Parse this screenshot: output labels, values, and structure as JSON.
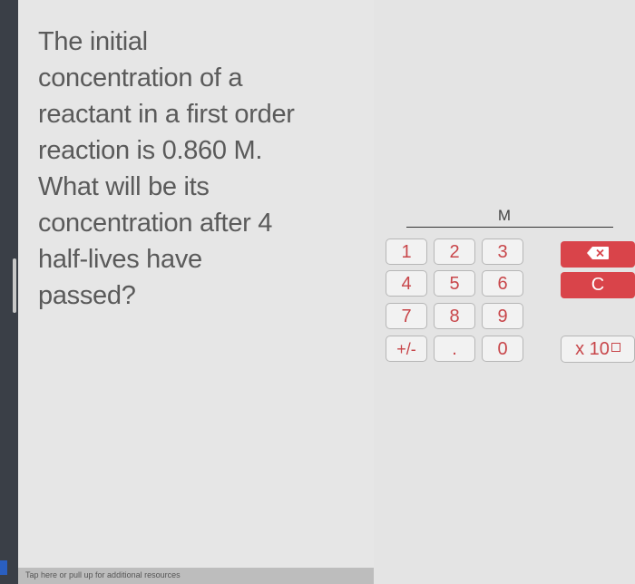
{
  "question": {
    "lines": [
      "The initial",
      "concentration of a",
      "reactant in a first order",
      "reaction is 0.860 M.",
      "What will be its",
      "concentration after 4",
      "half-lives have",
      "passed?"
    ]
  },
  "answer": {
    "value": "",
    "unit": "M"
  },
  "keypad": {
    "keys": [
      "1",
      "2",
      "3",
      "4",
      "5",
      "6",
      "7",
      "8",
      "9",
      "+/-",
      ".",
      "0"
    ],
    "backspace_icon": "backspace-icon",
    "clear_label": "C",
    "exponent_label": "x 10"
  },
  "footer": {
    "resources_label": "Tap here or pull up for additional resources"
  },
  "colors": {
    "accent_red": "#d9444a",
    "key_text": "#c8464a"
  }
}
